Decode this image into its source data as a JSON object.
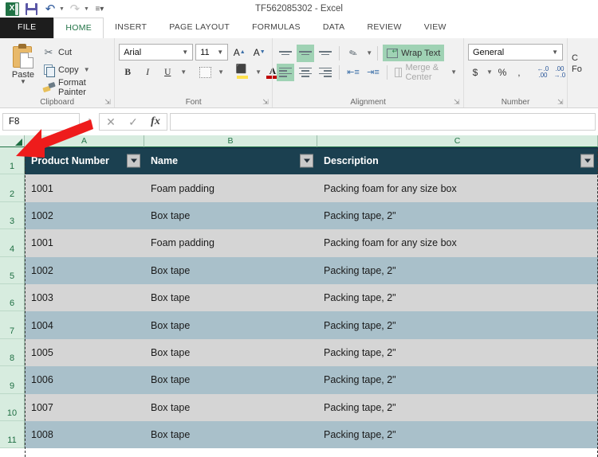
{
  "window": {
    "title": "TF562085302 - Excel"
  },
  "quick_access": {
    "logo": "excel-logo",
    "save": "save-icon",
    "undo": "undo-icon",
    "redo": "redo-icon",
    "customize": "customize-quick-access-icon"
  },
  "tabs": [
    {
      "label": "FILE",
      "active": false,
      "kind": "file"
    },
    {
      "label": "HOME",
      "active": true,
      "kind": "normal"
    },
    {
      "label": "INSERT",
      "active": false,
      "kind": "normal"
    },
    {
      "label": "PAGE LAYOUT",
      "active": false,
      "kind": "normal"
    },
    {
      "label": "FORMULAS",
      "active": false,
      "kind": "normal"
    },
    {
      "label": "DATA",
      "active": false,
      "kind": "normal"
    },
    {
      "label": "REVIEW",
      "active": false,
      "kind": "normal"
    },
    {
      "label": "VIEW",
      "active": false,
      "kind": "normal"
    }
  ],
  "ribbon": {
    "clipboard": {
      "group_label": "Clipboard",
      "paste_label": "Paste",
      "cut_label": "Cut",
      "copy_label": "Copy",
      "format_painter_label": "Format Painter"
    },
    "font": {
      "group_label": "Font",
      "font_name": "Arial",
      "font_size": "11",
      "bold_label": "B",
      "italic_label": "I",
      "underline_label": "U",
      "font_color_label": "A",
      "grow_font_label": "A",
      "shrink_font_label": "A"
    },
    "alignment": {
      "group_label": "Alignment",
      "wrap_text_label": "Wrap Text",
      "wrap_text_active": true,
      "merge_center_label": "Merge & Center",
      "merge_center_enabled": false
    },
    "number": {
      "group_label": "Number",
      "format_value": "General",
      "currency_label": "$",
      "percent_label": "%",
      "comma_label": ",",
      "increase_decimal": "increase-decimal-icon",
      "decrease_decimal": "decrease-decimal-icon"
    },
    "styles": {
      "line1": "C",
      "line2": "Fo"
    }
  },
  "formula_bar": {
    "name_box_value": "F8",
    "cancel_label": "✕",
    "enter_label": "✓",
    "insert_function_label": "fx",
    "formula_value": ""
  },
  "grid": {
    "columns": [
      {
        "letter": "A",
        "key": "cA"
      },
      {
        "letter": "B",
        "key": "cB"
      },
      {
        "letter": "C",
        "key": "cC"
      }
    ],
    "row_numbers": [
      "1",
      "2",
      "3",
      "4",
      "5",
      "6",
      "7",
      "8",
      "9",
      "10",
      "11"
    ],
    "header_row": [
      "Product Number",
      "Name",
      "Description"
    ],
    "rows": [
      [
        "1001",
        "Foam padding",
        "Packing foam for any size box"
      ],
      [
        "1002",
        "Box tape",
        "Packing tape, 2\""
      ],
      [
        "1001",
        "Foam padding",
        "Packing foam for any size box"
      ],
      [
        "1002",
        "Box tape",
        "Packing tape, 2\""
      ],
      [
        "1003",
        "Box tape",
        "Packing tape, 2\""
      ],
      [
        "1004",
        "Box tape",
        "Packing tape, 2\""
      ],
      [
        "1005",
        "Box tape",
        "Packing tape, 2\""
      ],
      [
        "1006",
        "Box tape",
        "Packing tape, 2\""
      ],
      [
        "1007",
        "Box tape",
        "Packing tape, 2\""
      ],
      [
        "1008",
        "Box tape",
        "Packing tape, 2\""
      ]
    ]
  },
  "annotation": {
    "arrow_color": "#ee1c1c",
    "points_to": "select-all-corner"
  },
  "colors": {
    "table_header_bg": "#1b4050",
    "band_light": "#d5d5d5",
    "band_dark": "#a9c0ca",
    "header_letters": "#217346",
    "ribbon_bg": "#f1f1f1",
    "accent_green": "#9fd2b4"
  }
}
